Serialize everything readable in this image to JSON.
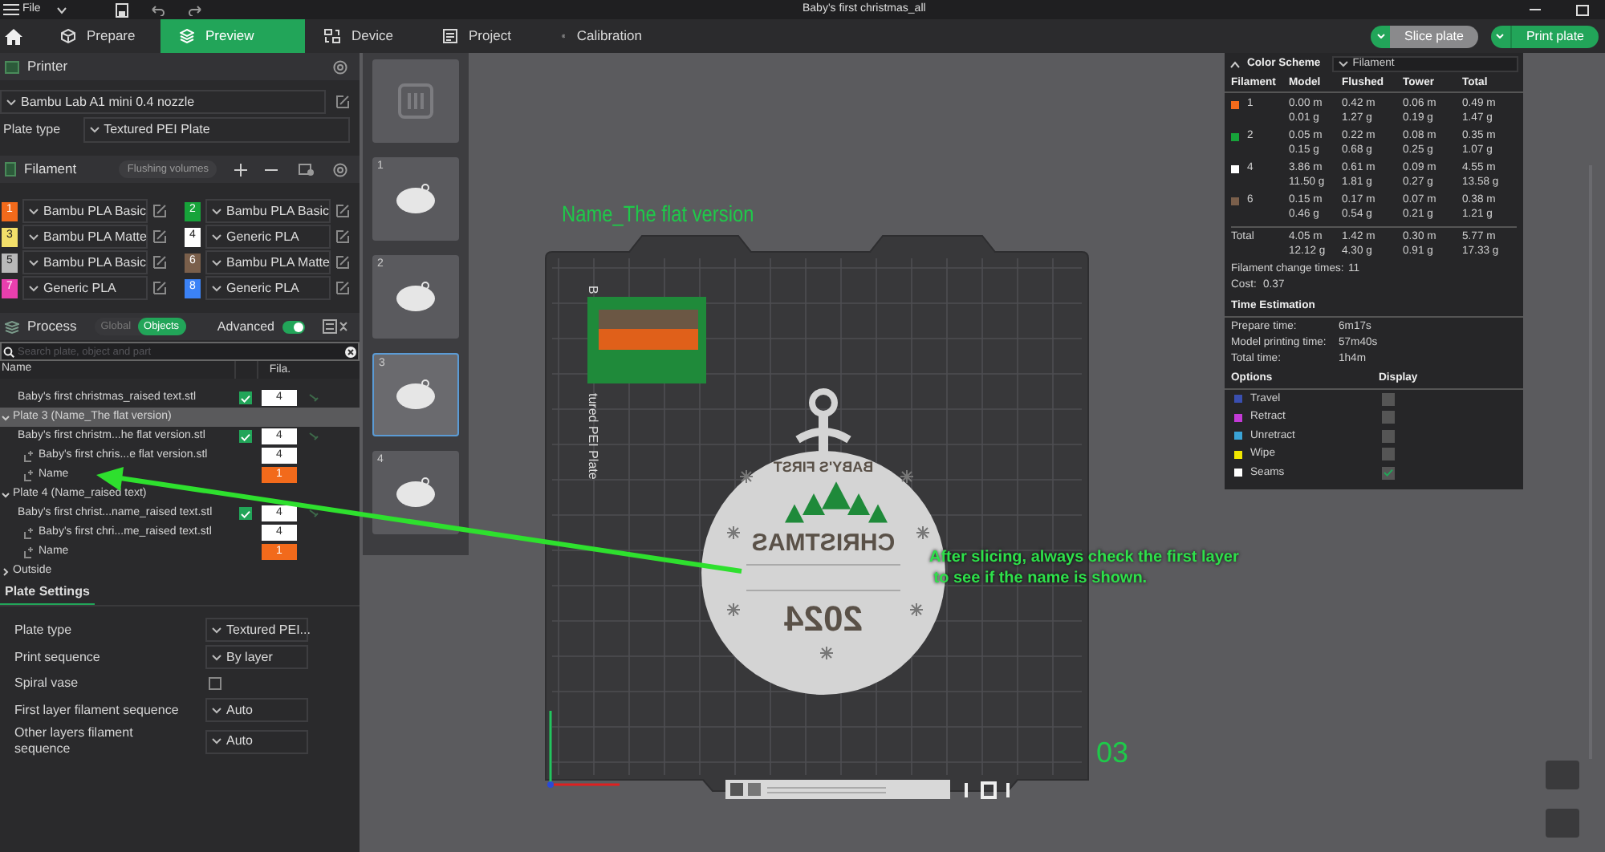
{
  "menu": {
    "label": "File"
  },
  "window": {
    "title": "Baby's first christmas_all"
  },
  "tabs": [
    {
      "label": "Prepare",
      "selected": false
    },
    {
      "label": "Preview",
      "selected": true
    },
    {
      "label": "Device",
      "selected": false
    },
    {
      "label": "Project",
      "selected": false
    },
    {
      "label": "Calibration",
      "selected": false
    }
  ],
  "actions": [
    {
      "label": "Slice plate",
      "kind": "secondary"
    },
    {
      "label": "Print plate",
      "kind": "primary"
    }
  ],
  "printer": {
    "title": "Printer",
    "model": "Bambu Lab A1 mini 0.4 nozzle",
    "plate_type_label": "Plate type",
    "plate_type": "Textured PEI Plate"
  },
  "filament": {
    "title": "Filament",
    "flushing_button": "Flushing volumes",
    "slots": [
      {
        "number": "1",
        "name": "Bambu PLA Basic",
        "color": "#f26a1b"
      },
      {
        "number": "2",
        "name": "Bambu PLA Basic",
        "color": "#17a33a"
      },
      {
        "number": "3",
        "name": "Bambu PLA Matte",
        "color": "#f3e06a"
      },
      {
        "number": "4",
        "name": "Generic PLA",
        "color": "#ffffff"
      },
      {
        "number": "5",
        "name": "Bambu PLA Basic",
        "color": "#b9b9b9"
      },
      {
        "number": "6",
        "name": "Bambu PLA Matte",
        "color": "#7a5f4b"
      },
      {
        "number": "7",
        "name": "Generic PLA",
        "color": "#e83fae"
      },
      {
        "number": "8",
        "name": "Generic PLA",
        "color": "#3b82f6"
      }
    ]
  },
  "process": {
    "title": "Process",
    "scope": [
      {
        "label": "Global",
        "selected": false
      },
      {
        "label": "Objects",
        "selected": true
      }
    ],
    "advanced_label": "Advanced",
    "advanced_on": true,
    "search_placeholder": "Search plate, object and part",
    "columns": [
      "Name",
      "Fila."
    ],
    "tree": [
      {
        "kind": "object",
        "label": "Baby's first christmas_raised text.stl",
        "checked": true,
        "filament": "4",
        "color": "#ffffff"
      },
      {
        "kind": "plate",
        "label": "Plate 3 (Name_The flat version)",
        "selected": true,
        "expanded": true,
        "children": [
          {
            "kind": "object",
            "label": "Baby's first christm...he flat version.stl",
            "checked": true,
            "filament": "4",
            "color": "#ffffff",
            "children": [
              {
                "kind": "part",
                "label": "Baby's first chris...e flat version.stl",
                "filament": "4",
                "color": "#ffffff"
              },
              {
                "kind": "part",
                "label": "Name",
                "filament": "1",
                "color": "#f26a1b"
              }
            ]
          }
        ]
      },
      {
        "kind": "plate",
        "label": "Plate 4 (Name_raised text)",
        "selected": false,
        "expanded": true,
        "children": [
          {
            "kind": "object",
            "label": "Baby's first christ...name_raised text.stl",
            "checked": true,
            "filament": "4",
            "color": "#ffffff",
            "children": [
              {
                "kind": "part",
                "label": "Baby's first chri...me_raised text.stl",
                "filament": "4",
                "color": "#ffffff"
              },
              {
                "kind": "part",
                "label": "Name",
                "filament": "1",
                "color": "#f26a1b"
              }
            ]
          }
        ]
      },
      {
        "kind": "plate",
        "label": "Outside",
        "selected": false,
        "expanded": false
      }
    ]
  },
  "plate_settings": {
    "title": "Plate Settings",
    "rows": [
      {
        "kind": "select",
        "label": "Plate type",
        "value": "Textured PEI..."
      },
      {
        "kind": "select",
        "label": "Print sequence",
        "value": "By layer"
      },
      {
        "kind": "checkbox",
        "label": "Spiral vase",
        "checked": false
      },
      {
        "kind": "select",
        "label": "First layer filament sequence",
        "value": "Auto"
      },
      {
        "kind": "select",
        "label": "Other layers filament sequence",
        "value": "Auto"
      }
    ]
  },
  "plates": [
    {
      "kind": "overview",
      "selected": false
    },
    {
      "kind": "plate",
      "label": "1",
      "selected": false
    },
    {
      "kind": "plate",
      "label": "2",
      "selected": false
    },
    {
      "kind": "plate",
      "label": "3",
      "selected": true
    },
    {
      "kind": "plate",
      "label": "4",
      "selected": false
    }
  ],
  "canvas": {
    "plate_name": "Name_The flat version",
    "bed_label_start": "B",
    "bed_label_end": "tured PEI Plate",
    "model_texts": [
      "BABY'S FIRST",
      "CHRISTMAS",
      "2024"
    ],
    "plate_number": "03",
    "annotation": "After slicing, always check the first layer\n to see if the name is shown."
  },
  "stats": {
    "color_scheme_label": "Color Scheme",
    "color_scheme": "Filament",
    "columns": [
      "Filament",
      "Model",
      "Flushed",
      "Tower",
      "Total"
    ],
    "rows": [
      {
        "filament": "1",
        "color": "#f26a1b",
        "model": "0.00 m\n0.01 g",
        "flushed": "0.42 m\n1.27 g",
        "tower": "0.06 m\n0.19 g",
        "total": "0.49 m\n1.47 g"
      },
      {
        "filament": "2",
        "color": "#17a33a",
        "model": "0.05 m\n0.15 g",
        "flushed": "0.22 m\n0.68 g",
        "tower": "0.08 m\n0.25 g",
        "total": "0.35 m\n1.07 g"
      },
      {
        "filament": "4",
        "color": "#ffffff",
        "model": "3.86 m\n11.50 g",
        "flushed": "0.61 m\n1.81 g",
        "tower": "0.09 m\n0.27 g",
        "total": "4.55 m\n13.58 g"
      },
      {
        "filament": "6",
        "color": "#7a5f4b",
        "model": "0.15 m\n0.46 g",
        "flushed": "0.17 m\n0.54 g",
        "tower": "0.07 m\n0.21 g",
        "total": "0.38 m\n1.21 g"
      }
    ],
    "total": {
      "label": "Total",
      "model": "4.05 m\n12.12 g",
      "flushed": "1.42 m\n4.30 g",
      "tower": "0.30 m\n0.91 g",
      "total": "5.77 m\n17.33 g"
    },
    "change_times_label": "Filament change times:",
    "change_times": "11",
    "cost_label": "Cost:",
    "cost": "0.37",
    "time_title": "Time Estimation",
    "times": [
      {
        "label": "Prepare time:",
        "value": "6m17s"
      },
      {
        "label": "Model printing time:",
        "value": "57m40s"
      },
      {
        "label": "Total time:",
        "value": "1h4m"
      }
    ],
    "options_title": "Options",
    "display_title": "Display",
    "options": [
      {
        "label": "Travel",
        "color": "#3a4fb0",
        "checked": false
      },
      {
        "label": "Retract",
        "color": "#c33ad6",
        "checked": false
      },
      {
        "label": "Unretract",
        "color": "#3aa3d6",
        "checked": false
      },
      {
        "label": "Wipe",
        "color": "#f0e600",
        "checked": false
      },
      {
        "label": "Seams",
        "color": "#ffffff",
        "checked": true
      }
    ]
  }
}
